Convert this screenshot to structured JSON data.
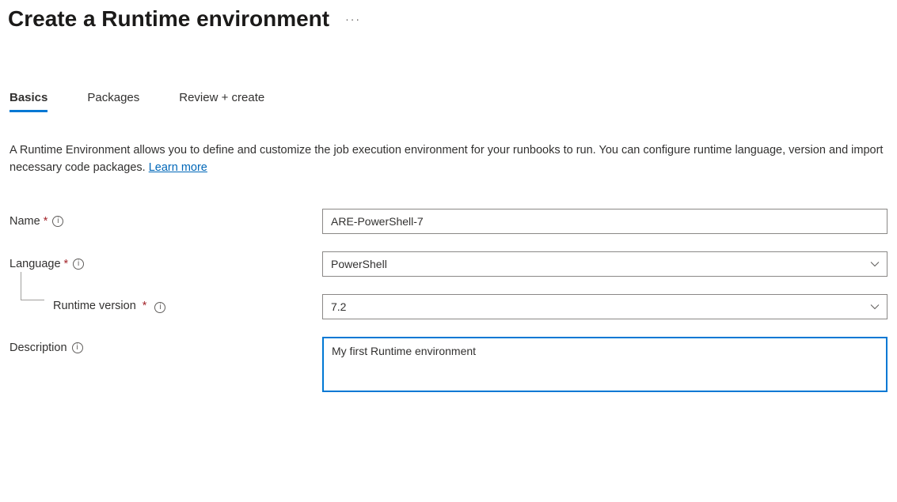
{
  "header": {
    "title": "Create a Runtime environment"
  },
  "tabs": [
    {
      "label": "Basics",
      "active": true
    },
    {
      "label": "Packages",
      "active": false
    },
    {
      "label": "Review + create",
      "active": false
    }
  ],
  "intro": {
    "text": "A Runtime Environment allows you to define and customize the job execution environment for your runbooks to run. You can configure runtime language, version and import necessary code packages. ",
    "learn_more": "Learn more"
  },
  "form": {
    "name": {
      "label": "Name",
      "value": "ARE-PowerShell-7",
      "required": true
    },
    "language": {
      "label": "Language",
      "value": "PowerShell",
      "required": true
    },
    "runtime_version": {
      "label": "Runtime version",
      "value": "7.2",
      "required": true
    },
    "description": {
      "label": "Description",
      "value": "My first Runtime environment",
      "required": false
    }
  }
}
